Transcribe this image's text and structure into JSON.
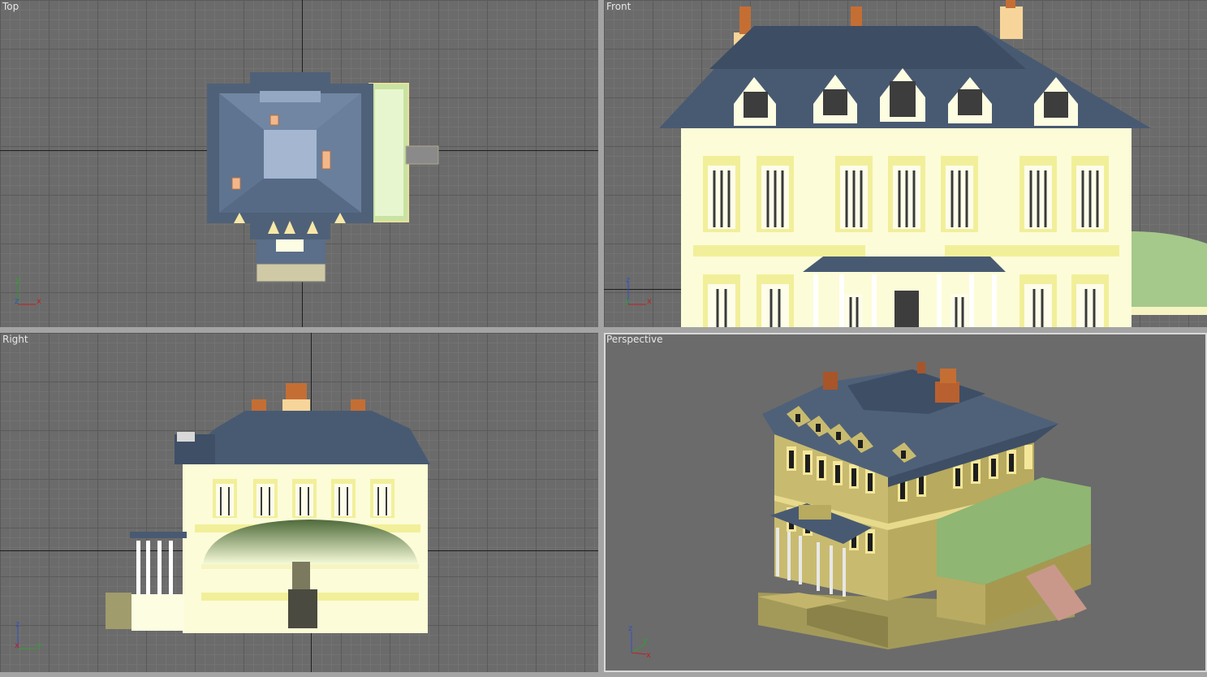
{
  "viewports": {
    "top": {
      "label": "Top"
    },
    "front": {
      "label": "Front"
    },
    "right": {
      "label": "Right"
    },
    "perspective": {
      "label": "Perspective"
    }
  },
  "axes": {
    "top": [
      "y",
      "z",
      "x"
    ],
    "front": [
      "z",
      "y",
      "x"
    ],
    "right": [
      "z",
      "x",
      "y"
    ],
    "perspective": [
      "z",
      "y",
      "x"
    ]
  },
  "colors": {
    "viewport_bg": "#6b6b6b",
    "roof": "#4f6178",
    "wall": "#fcfcd8",
    "trim": "#f2ef9a",
    "chimney": "#c8753a",
    "dome": "#a5c98a",
    "active_border": "#d8d8d8"
  },
  "icons": [
    "axis-tripod-icon"
  ]
}
